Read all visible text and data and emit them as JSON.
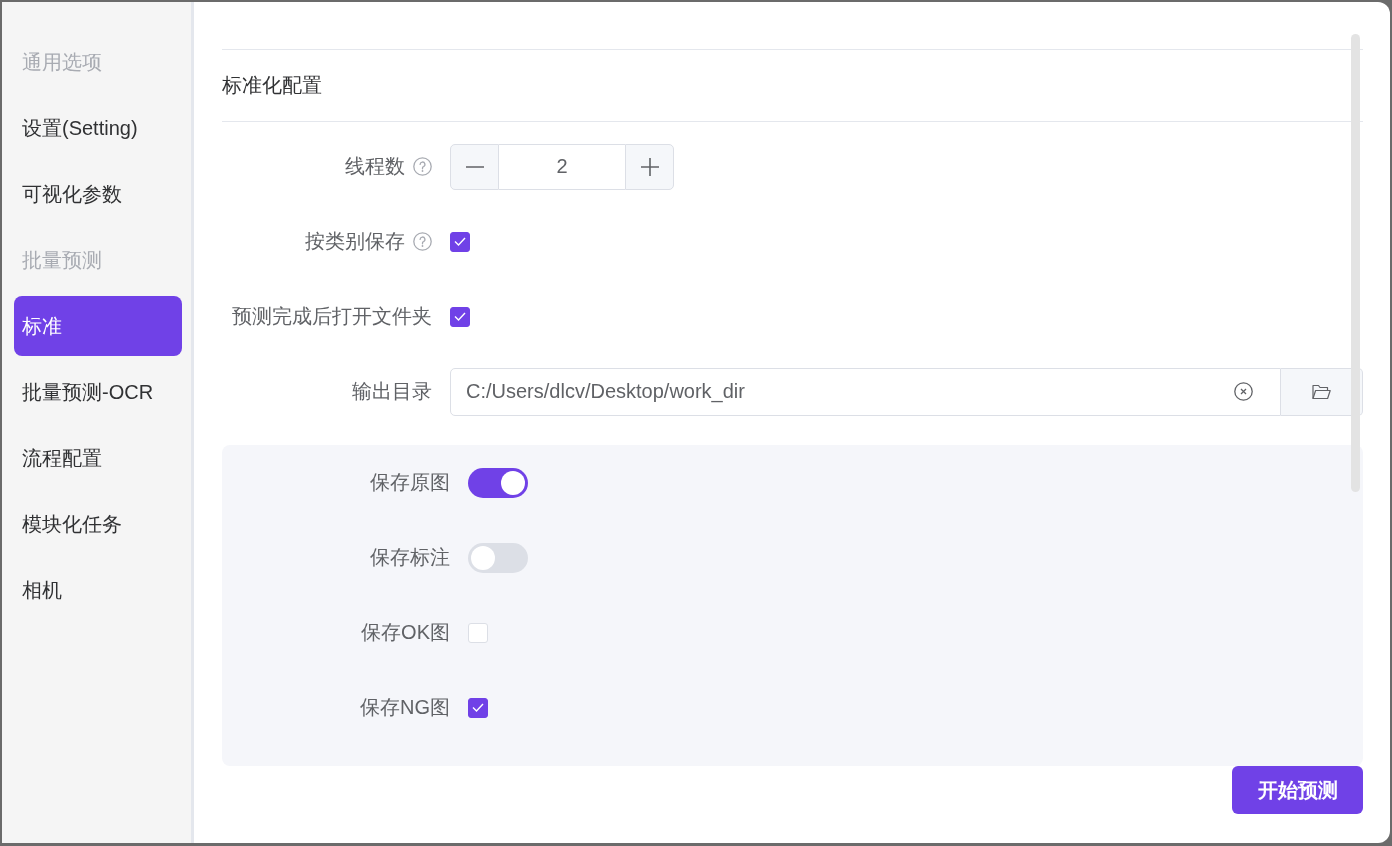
{
  "sidebar": {
    "items": [
      {
        "kind": "heading",
        "label": "通用选项",
        "selected": false
      },
      {
        "kind": "link",
        "label": "设置(Setting)",
        "selected": false
      },
      {
        "kind": "link",
        "label": "可视化参数",
        "selected": false
      },
      {
        "kind": "heading",
        "label": "批量预测",
        "selected": false
      },
      {
        "kind": "link",
        "label": "标准",
        "selected": true
      },
      {
        "kind": "link",
        "label": "批量预测-OCR",
        "selected": false
      },
      {
        "kind": "link",
        "label": "流程配置",
        "selected": false
      },
      {
        "kind": "link",
        "label": "模块化任务",
        "selected": false
      },
      {
        "kind": "link",
        "label": "相机",
        "selected": false
      }
    ]
  },
  "section": {
    "title": "标准化配置"
  },
  "form": {
    "rows": [
      {
        "kind": "number",
        "label": "线程数",
        "help": true,
        "value": "2"
      },
      {
        "kind": "checkbox",
        "label": "按类别保存",
        "help": true,
        "checked": true
      },
      {
        "kind": "checkbox",
        "label": "预测完成后打开文件夹",
        "help": false,
        "checked": true
      },
      {
        "kind": "path",
        "label": "输出目录",
        "help": false,
        "value": "C:/Users/dlcv/Desktop/work_dir"
      }
    ]
  },
  "save_options": {
    "rows": [
      {
        "kind": "switch",
        "label": "保存原图",
        "on": true
      },
      {
        "kind": "switch",
        "label": "保存标注",
        "on": false
      },
      {
        "kind": "checkbox",
        "label": "保存OK图",
        "checked": false
      },
      {
        "kind": "checkbox",
        "label": "保存NG图",
        "checked": true
      }
    ]
  },
  "start_button": {
    "label": "开始预测"
  }
}
